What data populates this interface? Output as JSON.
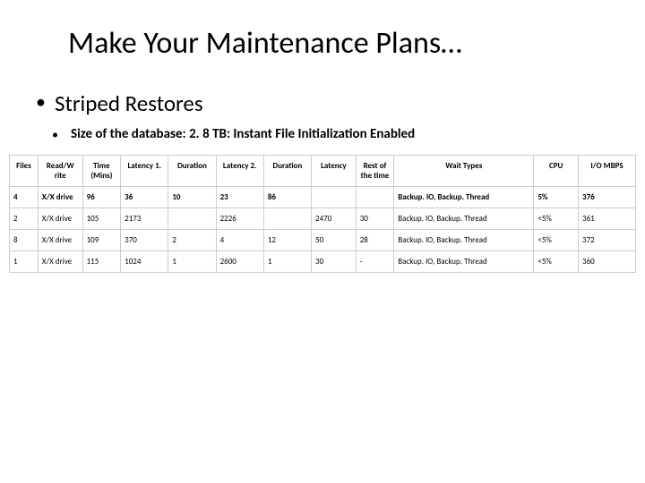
{
  "title": "Make Your Maintenance Plans…",
  "subtitle": "Striped Restores",
  "info_line": "Size of the database: 2. 8 TB: Instant File Initialization Enabled",
  "table": {
    "headers": {
      "files": "Files",
      "rw": "Read/W rite",
      "time": "Time (Mins)",
      "lat1": "Latency 1.",
      "dur1": "Duration",
      "lat2": "Latency 2.",
      "dur2": "Duration",
      "lat3": "Latency",
      "rest": "Rest of the time",
      "wait": "Wait Types",
      "cpu": "CPU",
      "io": "I/O MBPS"
    },
    "rows": [
      {
        "highlight": true,
        "files": "4",
        "rw": "X/X drive",
        "time": "96",
        "lat1": "36",
        "dur1": "10",
        "lat2": "23",
        "dur2": "86",
        "lat3": "",
        "rest": "",
        "wait": "Backup. IO, Backup. Thread",
        "cpu": "5%",
        "io": "376"
      },
      {
        "highlight": false,
        "files": "2",
        "rw": "X/X drive",
        "time": "105",
        "lat1": "2173",
        "dur1": "",
        "lat2": "2226",
        "dur2": "",
        "lat3": "2470",
        "rest": "30",
        "wait": "Backup. IO, Backup. Thread",
        "cpu": "<5%",
        "io": "361"
      },
      {
        "highlight": false,
        "files": "8",
        "rw": "X/X drive",
        "time": "109",
        "lat1": "370",
        "dur1": "2",
        "lat2": "4",
        "dur2": "12",
        "lat3": "50",
        "rest": "28",
        "wait": "Backup. IO, Backup. Thread",
        "cpu": "<5%",
        "io": "372"
      },
      {
        "highlight": false,
        "files": "1",
        "rw": "X/X drive",
        "time": "115",
        "lat1": "1024",
        "dur1": "1",
        "lat2": "2600",
        "dur2": "1",
        "lat3": "30",
        "rest": "-",
        "wait": "Backup. IO, Backup. Thread",
        "cpu": "<5%",
        "io": "360"
      }
    ]
  }
}
